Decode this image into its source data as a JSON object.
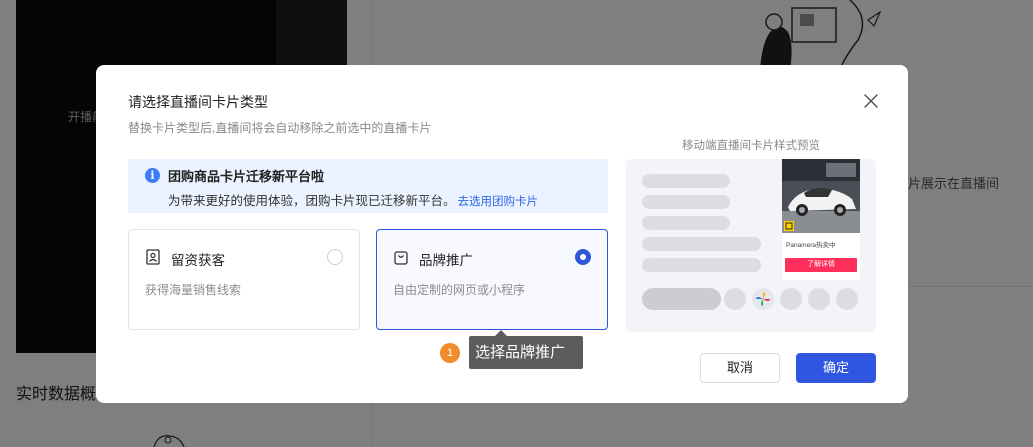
{
  "background": {
    "video_overlay_text": "开播前",
    "right_text": "片展示在直播间",
    "section_title": "实时数据概"
  },
  "modal": {
    "title": "请选择直播间卡片类型",
    "subtitle": "替换卡片类型后,直播间将会自动移除之前选中的直播卡片",
    "notice": {
      "icon": "info-icon",
      "title": "团购商品卡片迁移新平台啦",
      "text": "为带来更好的使用体验，团购卡片现已迁移新平台。",
      "link": "去选用团购卡片"
    },
    "options": [
      {
        "title": "留资获客",
        "description": "获得海量销售线索",
        "icon": "contact-card-icon",
        "selected": false
      },
      {
        "title": "品牌推广",
        "description": "自由定制的网页或小程序",
        "icon": "shopping-bag-icon",
        "selected": true
      }
    ],
    "preview": {
      "label": "移动端直播间卡片样式预览",
      "product_name": "Panamera热卖中",
      "product_button": "了解详情"
    },
    "tooltip": {
      "badge": "1",
      "text": "选择品牌推广"
    },
    "buttons": {
      "cancel": "取消",
      "confirm": "确定"
    }
  },
  "colors": {
    "primary": "#2f56e0",
    "notice_bg": "#eaf3ff",
    "link": "#2f66e8",
    "tooltip_badge": "#f28b2c",
    "product_button": "#ff2e5b"
  }
}
